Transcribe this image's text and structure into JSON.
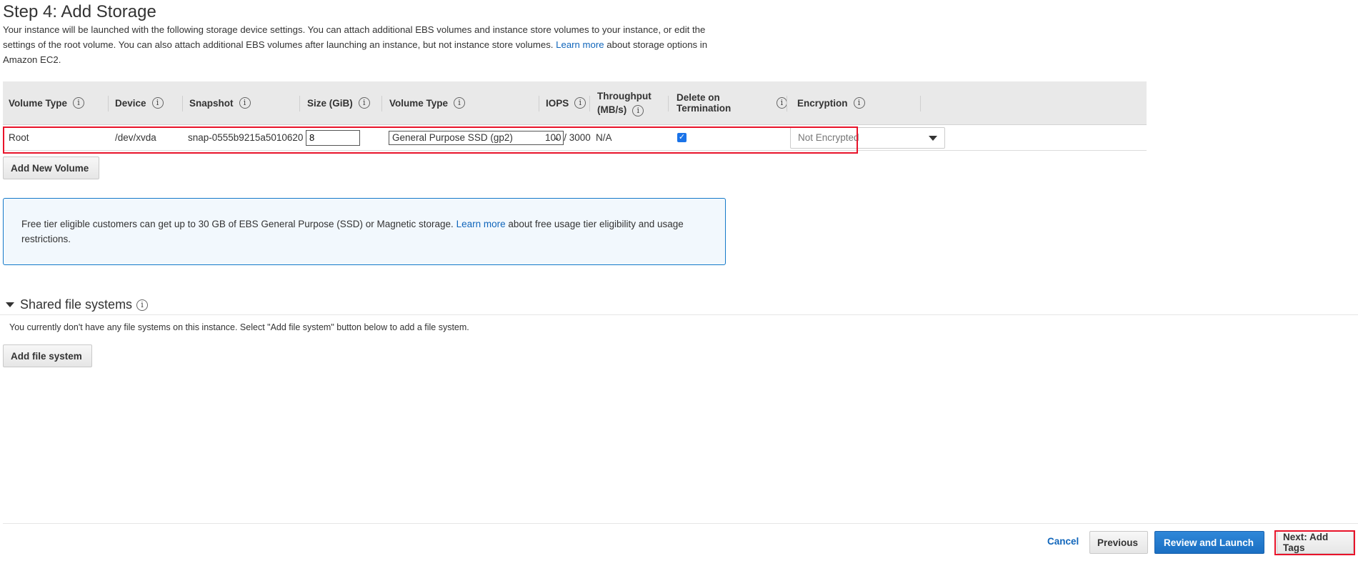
{
  "page": {
    "title": "Step 4: Add Storage",
    "description_part1": "Your instance will be launched with the following storage device settings. You can attach additional EBS volumes and instance store volumes to your instance, or edit the settings of the root volume. You can also attach additional EBS volumes after launching an instance, but not instance store volumes.",
    "description_link": "Learn more",
    "description_part2": "about storage options in Amazon EC2."
  },
  "table": {
    "headers": {
      "volume_type": "Volume Type",
      "device": "Device",
      "snapshot": "Snapshot",
      "size": "Size (GiB)",
      "volume_type2": "Volume Type",
      "iops": "IOPS",
      "throughput_line1": "Throughput",
      "throughput_line2": "(MB/s)",
      "delete_on_termination": "Delete on Termination",
      "encryption": "Encryption"
    },
    "info_glyph": "i",
    "row": {
      "volume_type": "Root",
      "device": "/dev/xvda",
      "snapshot": "snap-0555b9215a5010620",
      "size": "8",
      "volume_type_select": "General Purpose SSD (gp2)",
      "iops": "100 / 3000",
      "throughput": "N/A",
      "delete_on_termination": true,
      "encryption": "Not Encrypted"
    }
  },
  "buttons": {
    "add_new_volume": "Add New Volume",
    "add_file_system": "Add file system",
    "cancel": "Cancel",
    "previous": "Previous",
    "review_and_launch": "Review and Launch",
    "next": "Next: Add Tags"
  },
  "free_tier": {
    "text_part1": "Free tier eligible customers can get up to 30 GB of EBS General Purpose (SSD) or Magnetic storage.",
    "link": "Learn more",
    "text_part2": "about free usage tier eligibility and usage restrictions."
  },
  "shared_fs": {
    "title": "Shared file systems",
    "description": "You currently don't have any file systems on this instance. Select \"Add file system\" button below to add a file system."
  },
  "colors": {
    "link": "#1166bb",
    "primary_button": "#1a6fc3",
    "highlight": "#e8132a",
    "info_box_border": "#1479c9",
    "info_box_bg": "#f2f8fd"
  }
}
